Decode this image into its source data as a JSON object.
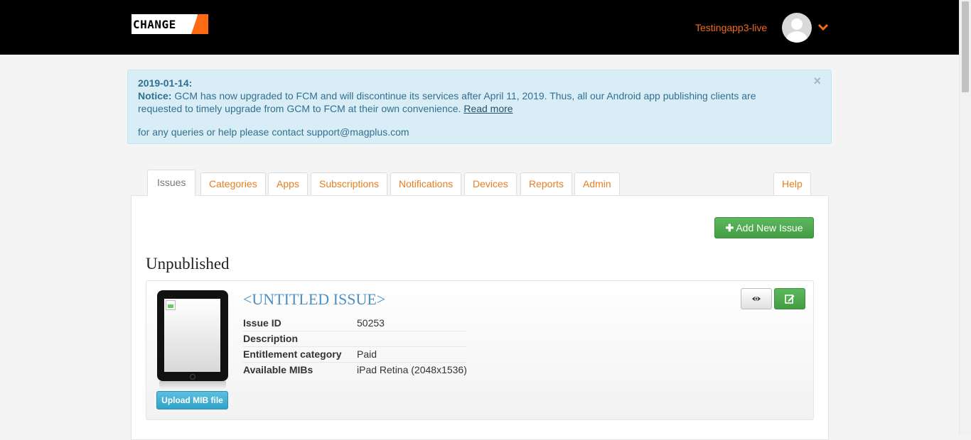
{
  "header": {
    "logo_text": "CHANGE",
    "username": "Testingapp3-live"
  },
  "notice": {
    "date": "2019-01-14:",
    "label": "Notice:",
    "message": " GCM has now upgraded to FCM and will discontinue its services after April 11, 2019. Thus, all our Android app publishing clients are requested to timely upgrade from GCM to FCM at their own convenience. ",
    "read_more": "Read more",
    "contact": "for any queries or help please contact support@magplus.com",
    "close": "×"
  },
  "tabs": [
    {
      "label": "Issues",
      "active": true
    },
    {
      "label": "Categories"
    },
    {
      "label": "Apps"
    },
    {
      "label": "Subscriptions"
    },
    {
      "label": "Notifications"
    },
    {
      "label": "Devices"
    },
    {
      "label": "Reports"
    },
    {
      "label": "Admin"
    },
    {
      "label": "Help"
    }
  ],
  "main": {
    "add_button": "Add New Issue",
    "section_title": "Unpublished",
    "issue": {
      "title": "<UNTITLED ISSUE>",
      "upload_button": "Upload MIB file",
      "fields": [
        {
          "key": "Issue ID",
          "value": "50253"
        },
        {
          "key": "Description",
          "value": ""
        },
        {
          "key": "Entitlement category",
          "value": "Paid"
        },
        {
          "key": "Available MIBs",
          "value": "iPad Retina (2048x1536)"
        }
      ]
    }
  },
  "colors": {
    "accent_orange": "#f26a1b",
    "success_green": "#5cb85c",
    "info_blue": "#5bc0de",
    "notice_bg": "#d9edf7"
  }
}
